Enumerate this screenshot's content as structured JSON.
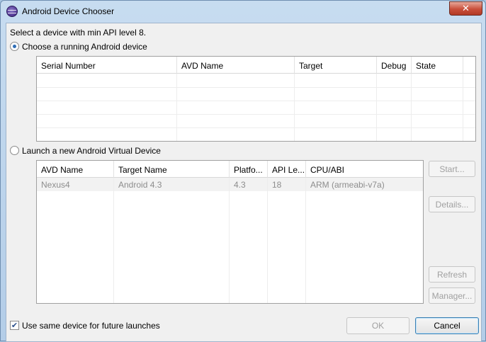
{
  "window": {
    "title": "Android Device Chooser",
    "close_glyph": "✕"
  },
  "instruction": "Select a device with min API level 8.",
  "running": {
    "option_label": "Choose a running Android device",
    "columns": [
      "Serial Number",
      "AVD Name",
      "Target",
      "Debug",
      "State"
    ]
  },
  "avd": {
    "option_label": "Launch a new Android Virtual Device",
    "columns": [
      "AVD Name",
      "Target Name",
      "Platfo...",
      "API Le...",
      "CPU/ABI"
    ],
    "rows": [
      [
        "Nexus4",
        "Android 4.3",
        "4.3",
        "18",
        "ARM (armeabi-v7a)"
      ]
    ],
    "buttons": {
      "start": "Start...",
      "details": "Details...",
      "refresh": "Refresh",
      "manager": "Manager..."
    }
  },
  "footer": {
    "checkbox_label": "Use same device for future launches",
    "checkbox_glyph": "✔",
    "ok_label": "OK",
    "cancel_label": "Cancel"
  }
}
